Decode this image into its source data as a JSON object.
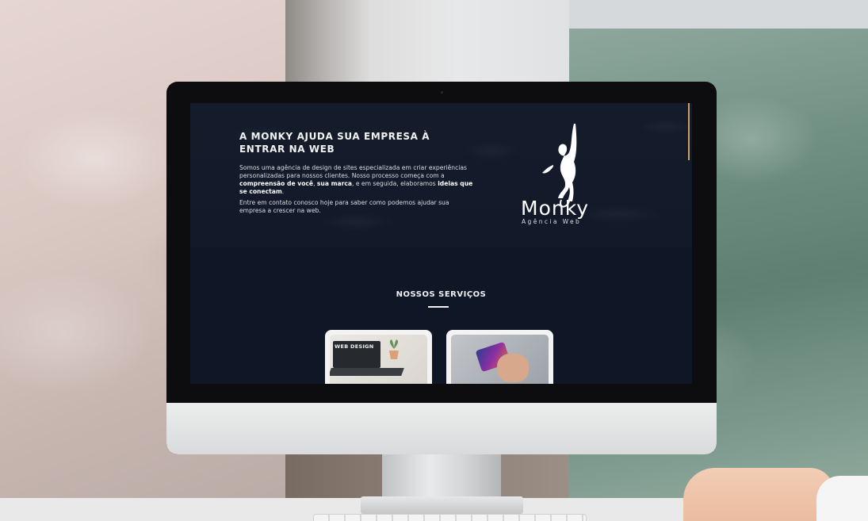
{
  "website": {
    "hero": {
      "title": "A MONKY AJUDA SUA EMPRESA À ENTRAR NA WEB",
      "paragraph1_part1": "Somos uma agência de design de sites especializada em criar experiências personalizadas para nossos clientes. Nosso processo começa com a ",
      "paragraph1_bold1": "compreensão de você",
      "paragraph1_sep": ", ",
      "paragraph1_bold2": "sua marca",
      "paragraph1_part2": ", e em seguida, elaboramos ",
      "paragraph1_bold3": "ideias que se conectam",
      "paragraph1_end": ".",
      "paragraph2": "Entre em contato conosco hoje para saber como podemos ajudar sua empresa a crescer na web."
    },
    "logo": {
      "name": "Monky",
      "tagline": "Agência Web",
      "icon": "hanging-monkey-icon"
    },
    "services": {
      "title": "NOSSOS SERVIÇOS",
      "cards": [
        {
          "image_label": "WEB DESIGN",
          "icon": "laptop-image"
        },
        {
          "icon": "smartphone-image"
        }
      ]
    }
  },
  "colors": {
    "site_background": "#0f1626",
    "accent": "#c9a26a",
    "text": "#f1f1f1"
  }
}
